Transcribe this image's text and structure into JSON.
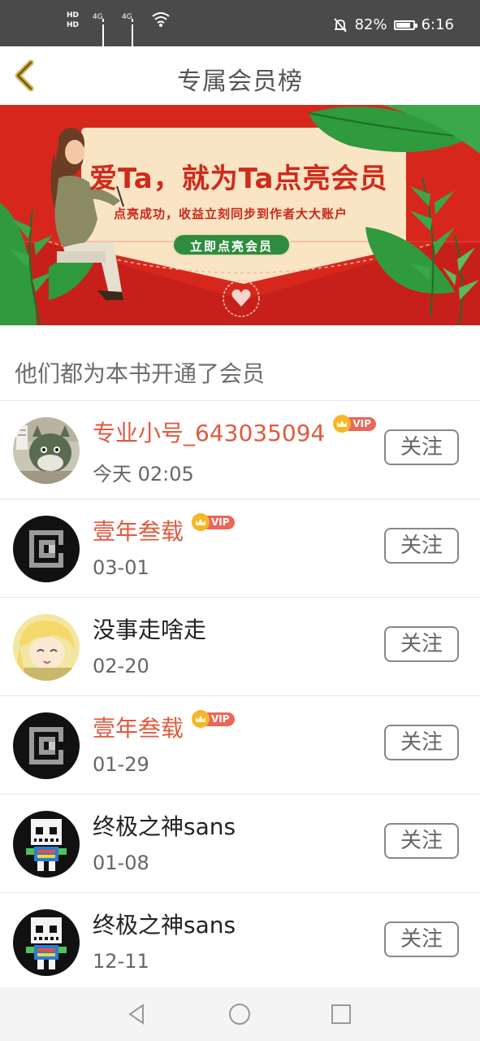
{
  "status_bar": {
    "hd1": "HD",
    "hd2": "HD",
    "signal1": "4G",
    "signal2": "4G",
    "battery": "82%",
    "time": "6:16"
  },
  "header": {
    "title": "专属会员榜",
    "back_icon": "chevron-left-icon"
  },
  "banner": {
    "headline": "爱Ta，就为Ta点亮会员",
    "subtitle": "点亮成功，收益立刻同步到作者大大账户",
    "cta_label": "立即点亮会员",
    "colors": {
      "background": "#d7271d",
      "card": "#f9e4c4",
      "cta": "#2f8c3e",
      "leaf": "#2f9a3e"
    }
  },
  "section_label": "他们都为本书开通了会员",
  "vip_badge_text": "VIP",
  "members": [
    {
      "name": "专业小号_643035094",
      "vip": true,
      "date": "今天 02:05",
      "follow_label": "关注",
      "avatar": "cat-avatar"
    },
    {
      "name": "壹年叁载",
      "vip": true,
      "date": "03-01",
      "follow_label": "关注",
      "avatar": "pixel-c-avatar"
    },
    {
      "name": "没事走啥走",
      "vip": false,
      "date": "02-20",
      "follow_label": "关注",
      "avatar": "anime-girl-avatar"
    },
    {
      "name": "壹年叁载",
      "vip": true,
      "date": "01-29",
      "follow_label": "关注",
      "avatar": "pixel-c-avatar"
    },
    {
      "name": "终极之神sans",
      "vip": false,
      "date": "01-08",
      "follow_label": "关注",
      "avatar": "pixel-skull-avatar"
    },
    {
      "name": "终极之神sans",
      "vip": false,
      "date": "12-11",
      "follow_label": "关注",
      "avatar": "pixel-skull-avatar"
    }
  ],
  "colors": {
    "vip_name": "#e05a3f",
    "accent_back": "#c9a23a"
  },
  "nav_bar": {
    "icons": [
      "back-triangle-icon",
      "home-circle-icon",
      "recents-square-icon"
    ]
  }
}
